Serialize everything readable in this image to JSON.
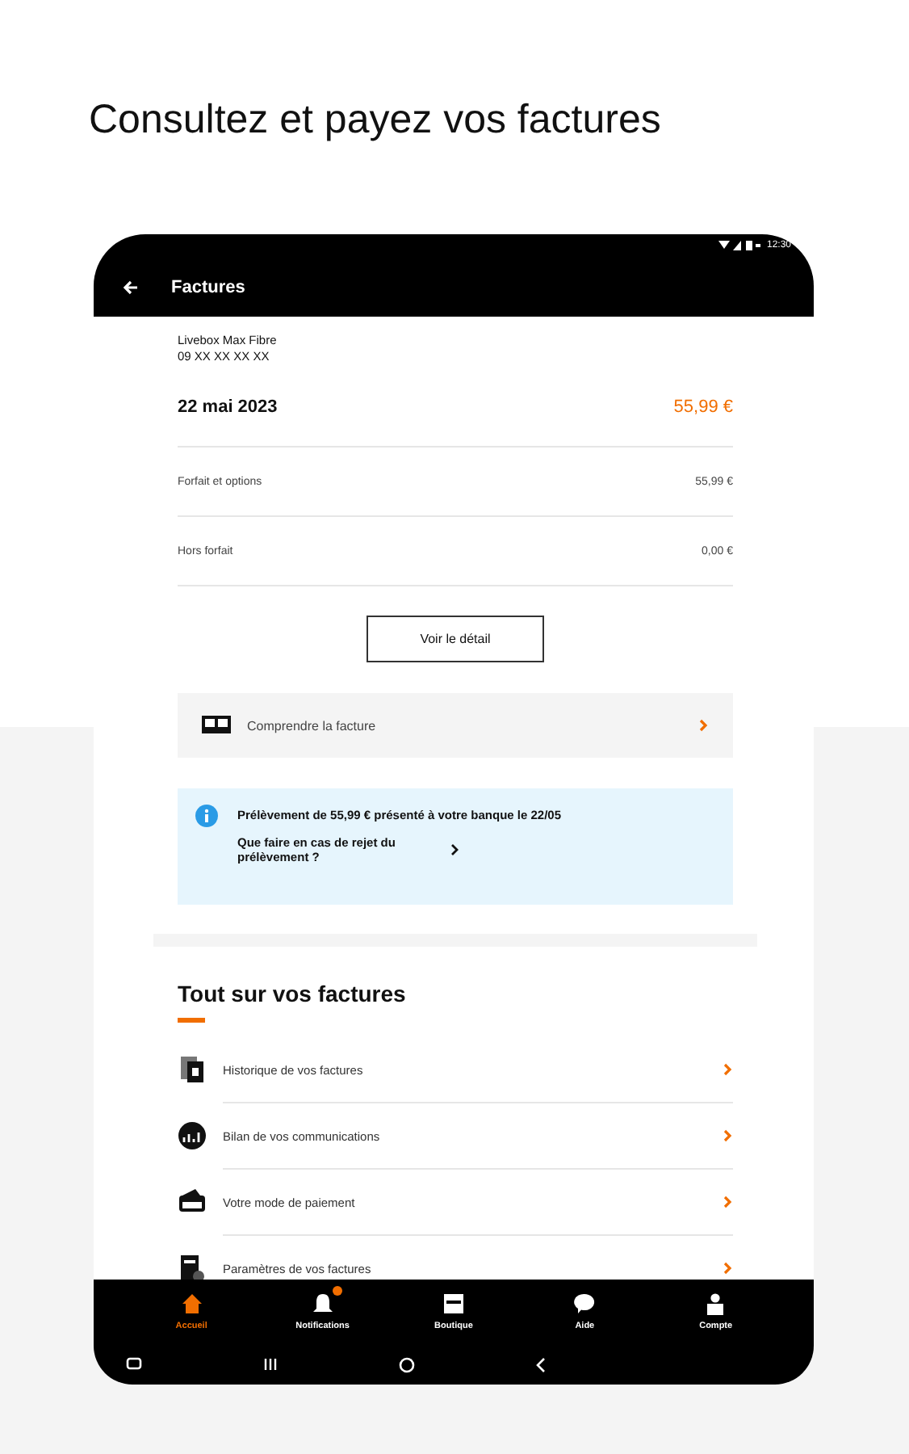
{
  "headline": "Consultez et payez vos factures",
  "status_bar": {
    "time": "12:30"
  },
  "app_bar": {
    "title": "Factures"
  },
  "invoice": {
    "offer": "Livebox Max Fibre",
    "number": "09 XX XX XX XX",
    "date": "22 mai 2023",
    "amount": "55,99 €",
    "lines": [
      {
        "label": "Forfait et options",
        "value": "55,99 €"
      },
      {
        "label": "Hors forfait",
        "value": "0,00 €"
      }
    ],
    "detail_button": "Voir le détail"
  },
  "understand_link": "Comprendre la facture",
  "info": {
    "message": "Prélèvement de 55,99 € présenté à votre banque le 22/05",
    "link": "Que faire en cas de rejet du prélèvement ?"
  },
  "section": {
    "title": "Tout sur vos factures",
    "items": [
      "Historique de vos factures",
      "Bilan de vos communications",
      "Votre mode de paiement",
      "Paramètres de vos factures"
    ]
  },
  "bottom_nav": [
    {
      "label": "Accueil",
      "selected": true,
      "badge": false
    },
    {
      "label": "Notifications",
      "selected": false,
      "badge": true
    },
    {
      "label": "Boutique",
      "selected": false,
      "badge": false
    },
    {
      "label": "Aide",
      "selected": false,
      "badge": false
    },
    {
      "label": "Compte",
      "selected": false,
      "badge": false
    }
  ]
}
